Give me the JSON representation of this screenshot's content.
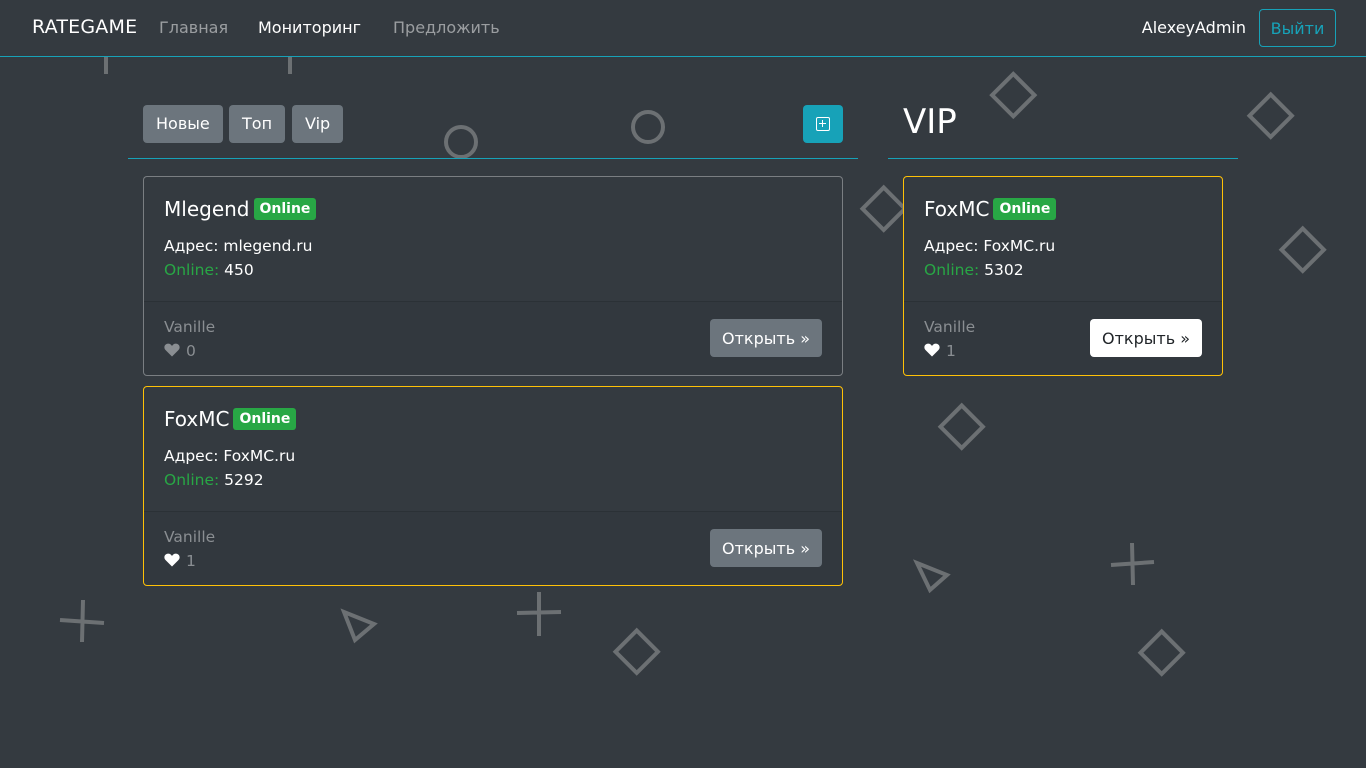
{
  "navbar": {
    "brand": "RATEGAME",
    "links": [
      {
        "label": "Главная",
        "active": false
      },
      {
        "label": "Мониторинг",
        "active": true
      },
      {
        "label": "Предложить",
        "active": false
      }
    ],
    "username": "AlexeyAdmin",
    "logout_label": "Выйти"
  },
  "filters": [
    "Новые",
    "Топ",
    "Vip"
  ],
  "add_button_icon": "plus-square-icon",
  "vip_title": "VIP",
  "servers": [
    {
      "name": "Mlegend",
      "status": "Online",
      "address_label": "Адрес:",
      "address": "mlegend.ru",
      "online_label": "Online:",
      "online": "450",
      "version": "Vanille",
      "likes": "0",
      "liked": false,
      "vip": false,
      "open_label": "Открыть »"
    },
    {
      "name": "FoxMC",
      "status": "Online",
      "address_label": "Адрес:",
      "address": "FoxMC.ru",
      "online_label": "Online:",
      "online": "5292",
      "version": "Vanille",
      "likes": "1",
      "liked": true,
      "vip": true,
      "open_label": "Открыть »"
    }
  ],
  "vip_servers": [
    {
      "name": "FoxMC",
      "status": "Online",
      "address_label": "Адрес:",
      "address": "FoxMC.ru",
      "online_label": "Online:",
      "online": "5302",
      "version": "Vanille",
      "likes": "1",
      "liked": true,
      "vip": true,
      "open_label": "Открыть »"
    }
  ],
  "colors": {
    "background": "#343a40",
    "accent": "#17a2b8",
    "online": "#28a745",
    "vip_border": "#ffc107",
    "secondary": "#6c757d"
  }
}
